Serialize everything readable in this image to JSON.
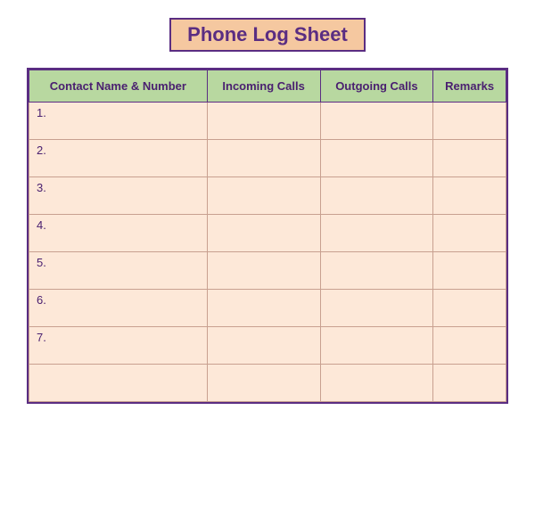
{
  "title": "Phone Log Sheet",
  "columns": [
    {
      "id": "contact",
      "label": "Contact Name & Number"
    },
    {
      "id": "incoming",
      "label": "Incoming Calls"
    },
    {
      "id": "outgoing",
      "label": "Outgoing Calls"
    },
    {
      "id": "remarks",
      "label": "Remarks"
    }
  ],
  "rows": [
    {
      "num": "1."
    },
    {
      "num": "2."
    },
    {
      "num": "3."
    },
    {
      "num": "4."
    },
    {
      "num": "5."
    },
    {
      "num": "6."
    },
    {
      "num": "7."
    },
    {
      "num": ""
    }
  ]
}
